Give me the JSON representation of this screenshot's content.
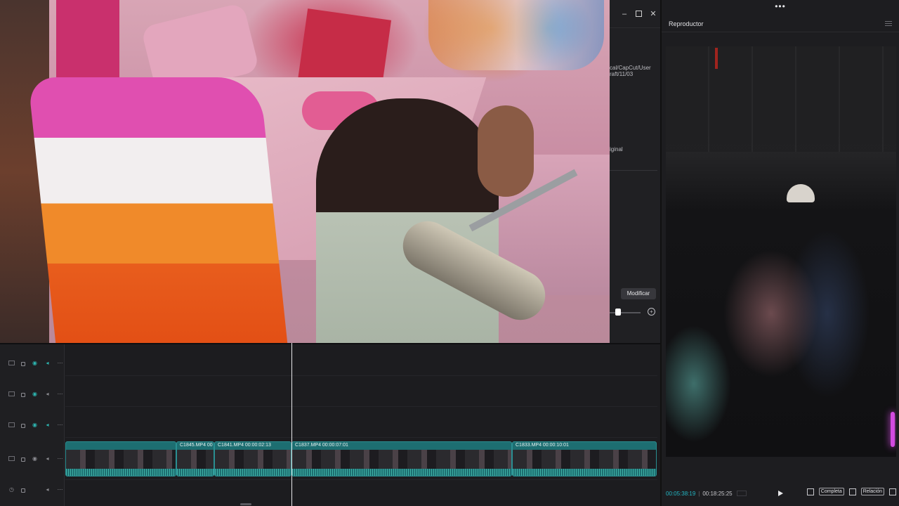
{
  "editor": {
    "path": "cal/CapCut/User\nraft/11/03",
    "original_label": "iginal",
    "modify_button": "Modificar"
  },
  "player": {
    "top_dots": "•••",
    "title": "Reproductor",
    "time_current": "00:05:38:19",
    "time_total": "00:18:25:25",
    "btn_full": "Completa",
    "btn_ratio": "Relación"
  },
  "timeline": {
    "tracks": [
      {
        "name": "track-1",
        "type": "overlay"
      },
      {
        "name": "track-2",
        "type": "overlay"
      },
      {
        "name": "track-3",
        "type": "overlay"
      },
      {
        "name": "main-track",
        "type": "video"
      },
      {
        "name": "audio-track",
        "type": "audio"
      }
    ],
    "clips": [
      {
        "label": ""
      },
      {
        "label": "C1845.MP4  00"
      },
      {
        "label": "C1841.MP4  00:00:02:13"
      },
      {
        "label": "C1837.MP4  00:00:07:01"
      },
      {
        "label": "C1833.MP4  00:00:10:01"
      }
    ]
  },
  "colors": {
    "accent": "#23b6c3",
    "clip": "#1d6e71",
    "background": "#1c1c1f"
  }
}
